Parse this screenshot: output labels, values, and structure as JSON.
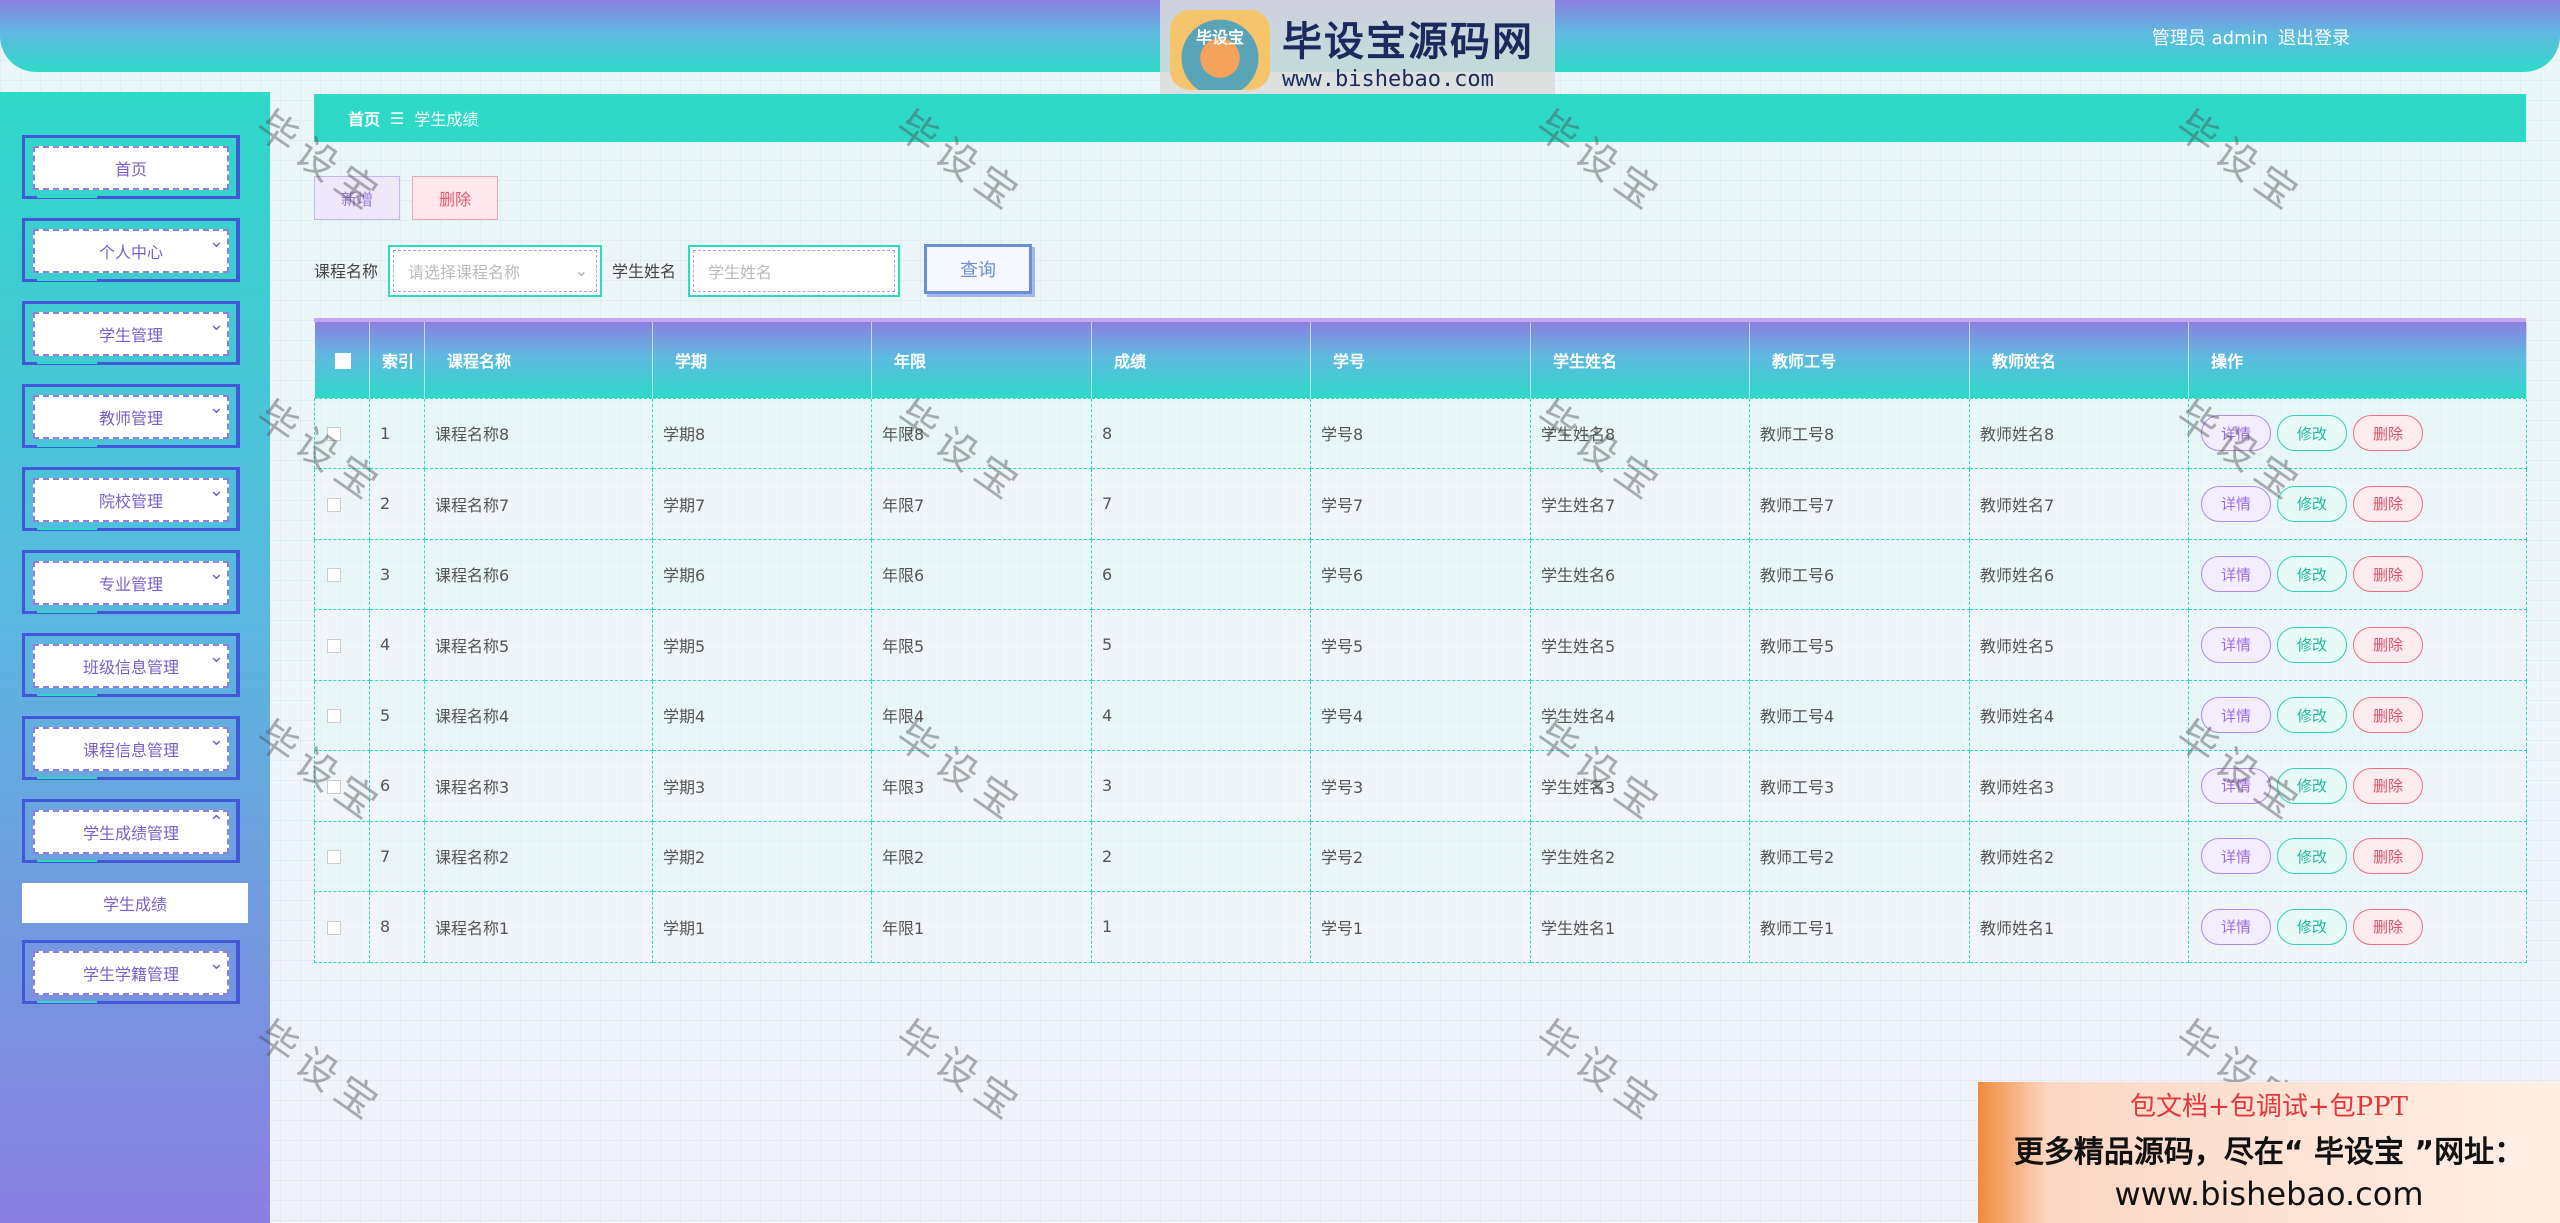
{
  "header": {
    "user_label": "管理员 admin",
    "logout_label": "退出登录"
  },
  "watermark_logo": {
    "badge_text": "毕设宝",
    "title": "毕设宝源码网",
    "url": "www.bishebao.com"
  },
  "sidebar": {
    "items": [
      {
        "label": "首页",
        "expandable": false
      },
      {
        "label": "个人中心",
        "expandable": true
      },
      {
        "label": "学生管理",
        "expandable": true
      },
      {
        "label": "教师管理",
        "expandable": true
      },
      {
        "label": "院校管理",
        "expandable": true
      },
      {
        "label": "专业管理",
        "expandable": true
      },
      {
        "label": "班级信息管理",
        "expandable": true
      },
      {
        "label": "课程信息管理",
        "expandable": true
      },
      {
        "label": "学生成绩管理",
        "expandable": true,
        "expanded": true
      },
      {
        "label": "学生学籍管理",
        "expandable": true
      }
    ],
    "sub_item": "学生成绩"
  },
  "breadcrumb": {
    "home": "首页",
    "separator": "☰",
    "current": "学生成绩"
  },
  "toolbar": {
    "add_label": "新增",
    "delete_label": "删除"
  },
  "search": {
    "course_label": "课程名称",
    "course_placeholder": "请选择课程名称",
    "student_label": "学生姓名",
    "student_placeholder": "学生姓名",
    "query_label": "查询"
  },
  "table": {
    "headers": [
      "",
      "索引",
      "课程名称",
      "学期",
      "年限",
      "成绩",
      "学号",
      "学生姓名",
      "教师工号",
      "教师姓名",
      "操作"
    ],
    "rows": [
      {
        "index": "1",
        "course": "课程名称8",
        "term": "学期8",
        "year": "年限8",
        "score": "8",
        "student_no": "学号8",
        "student_name": "学生姓名8",
        "teacher_no": "教师工号8",
        "teacher_name": "教师姓名8"
      },
      {
        "index": "2",
        "course": "课程名称7",
        "term": "学期7",
        "year": "年限7",
        "score": "7",
        "student_no": "学号7",
        "student_name": "学生姓名7",
        "teacher_no": "教师工号7",
        "teacher_name": "教师姓名7"
      },
      {
        "index": "3",
        "course": "课程名称6",
        "term": "学期6",
        "year": "年限6",
        "score": "6",
        "student_no": "学号6",
        "student_name": "学生姓名6",
        "teacher_no": "教师工号6",
        "teacher_name": "教师姓名6"
      },
      {
        "index": "4",
        "course": "课程名称5",
        "term": "学期5",
        "year": "年限5",
        "score": "5",
        "student_no": "学号5",
        "student_name": "学生姓名5",
        "teacher_no": "教师工号5",
        "teacher_name": "教师姓名5"
      },
      {
        "index": "5",
        "course": "课程名称4",
        "term": "学期4",
        "year": "年限4",
        "score": "4",
        "student_no": "学号4",
        "student_name": "学生姓名4",
        "teacher_no": "教师工号4",
        "teacher_name": "教师姓名4"
      },
      {
        "index": "6",
        "course": "课程名称3",
        "term": "学期3",
        "year": "年限3",
        "score": "3",
        "student_no": "学号3",
        "student_name": "学生姓名3",
        "teacher_no": "教师工号3",
        "teacher_name": "教师姓名3"
      },
      {
        "index": "7",
        "course": "课程名称2",
        "term": "学期2",
        "year": "年限2",
        "score": "2",
        "student_no": "学号2",
        "student_name": "学生姓名2",
        "teacher_no": "教师工号2",
        "teacher_name": "教师姓名2"
      },
      {
        "index": "8",
        "course": "课程名称1",
        "term": "学期1",
        "year": "年限1",
        "score": "1",
        "student_no": "学号1",
        "student_name": "学生姓名1",
        "teacher_no": "教师工号1",
        "teacher_name": "教师姓名1"
      }
    ],
    "actions": {
      "detail": "详情",
      "edit": "修改",
      "delete": "删除"
    }
  },
  "watermark_text": "毕设宝",
  "ad": {
    "line1": "包文档+包调试+包PPT",
    "line2": "更多精品源码，尽在“ 毕设宝 ”网址：",
    "line3": "www.bishebao.com"
  },
  "colors": {
    "accent": "#2fd9c8",
    "purple": "#8b7fe0",
    "danger": "#e04f67"
  }
}
